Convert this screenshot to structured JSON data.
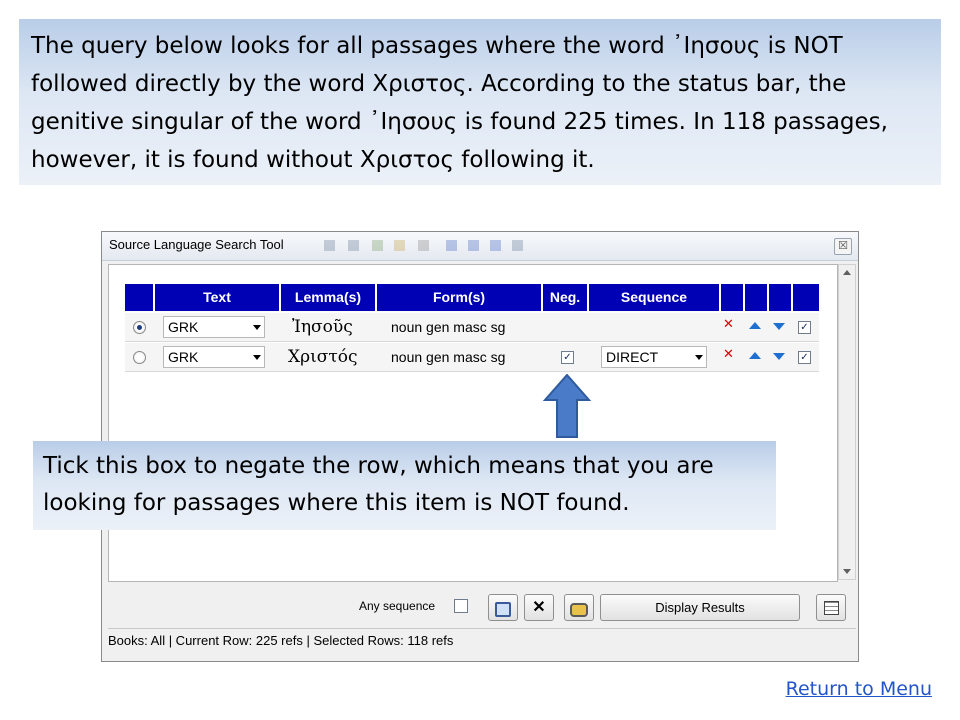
{
  "top_callout": "The query below looks for all passages where the word ᾿Ιησους is NOT followed directly by the word Χριστος. According to the status bar, the genitive singular of the word ᾿Ιησους is found 225 times. In 118 passages, however, it is found without Χριστος following it.",
  "window": {
    "title": "Source Language Search Tool",
    "close_glyph": "☒"
  },
  "grid": {
    "headers": [
      "Text",
      "Lemma(s)",
      "Form(s)",
      "Neg.",
      "Sequence"
    ],
    "rows": [
      {
        "selected": true,
        "text": "GRK",
        "lemma": "Ἰησοῦς",
        "form": "noun gen masc sg",
        "neg": false,
        "sequence": "",
        "checked": true
      },
      {
        "selected": false,
        "text": "GRK",
        "lemma": "Χριστός",
        "form": "noun gen masc sg",
        "neg": true,
        "sequence": "DIRECT",
        "checked": true
      }
    ],
    "delete_glyph": "✕",
    "check_glyph": "✓"
  },
  "mid_callout": "Tick this box to negate the row, which means that you are looking for passages where this item is NOT found.",
  "bottom": {
    "any_sequence_label": "Any sequence",
    "display_results_label": "Display Results",
    "clear_glyph": "✕"
  },
  "status_bar": "Books: All | Current Row: 225 refs | Selected Rows: 118 refs",
  "return_link": "Return to Menu",
  "colors": {
    "header_blue": "#0000b4",
    "callout_top": "#b9cde8",
    "callout_bottom": "#ecf1f8",
    "arrow_blue": "#4a7bc8",
    "link": "#2255c8"
  }
}
